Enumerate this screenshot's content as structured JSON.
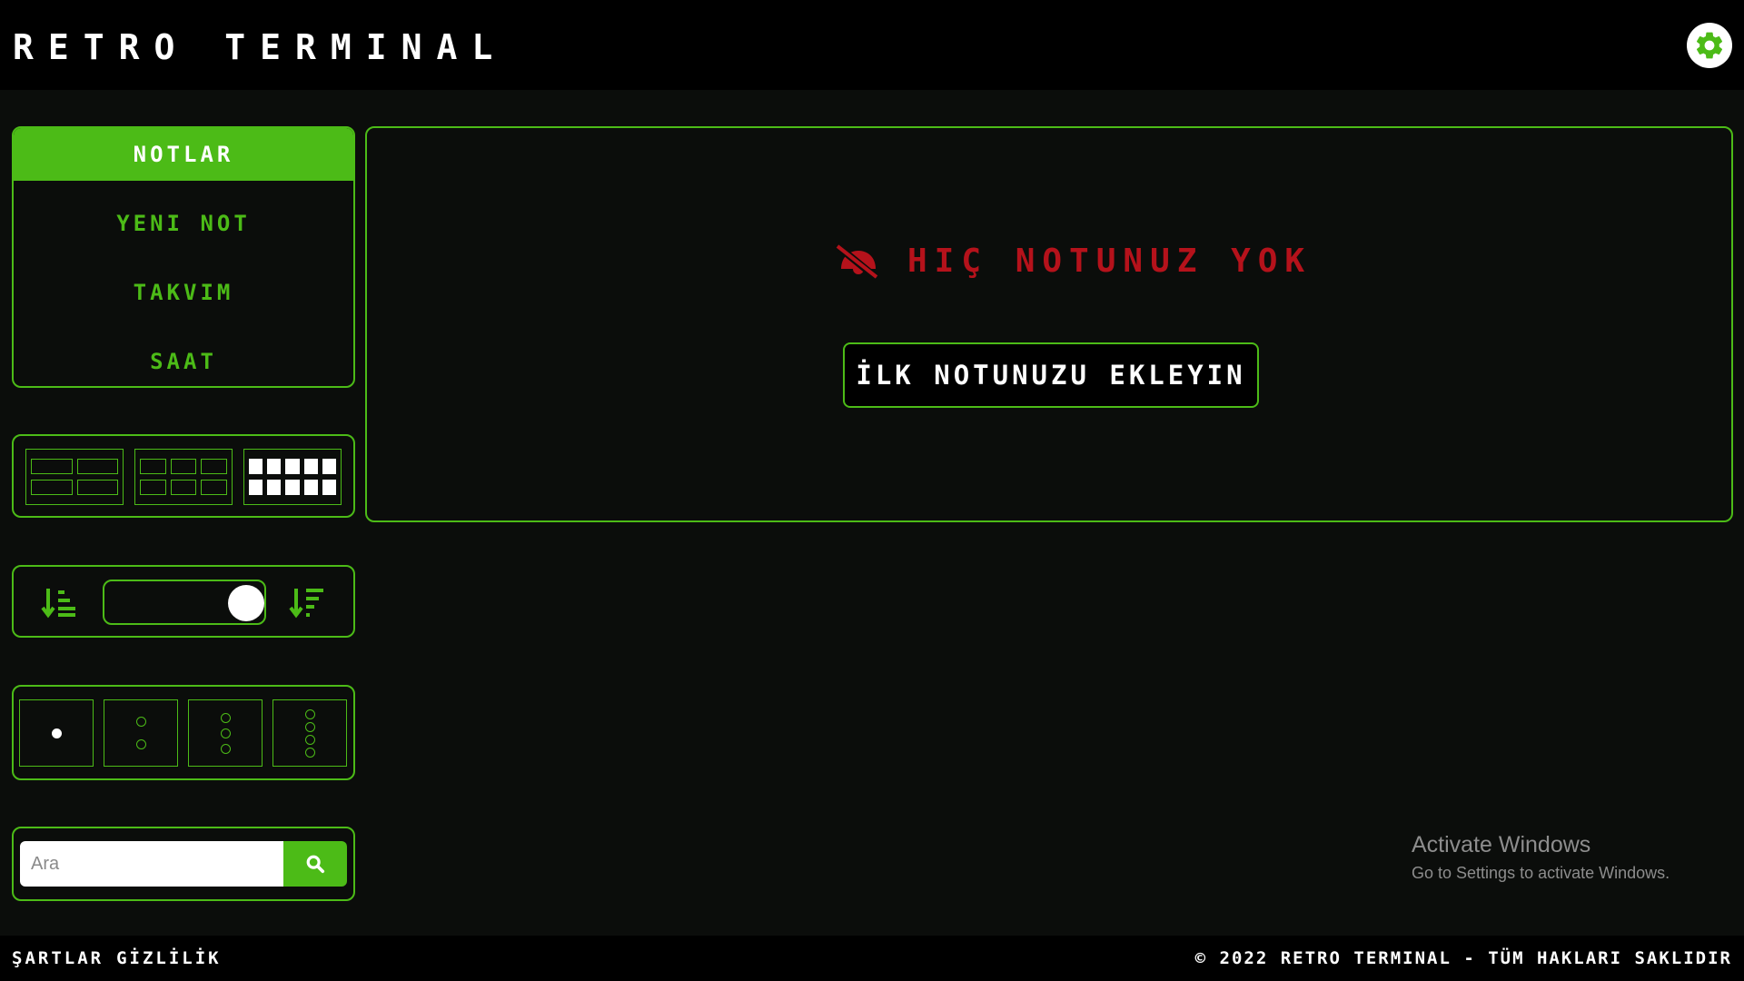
{
  "app": {
    "title": "RETRO TERMINAL"
  },
  "header": {
    "settings_icon": "gear-icon",
    "settings_color": "#4cbb17"
  },
  "sidebar": {
    "nav": [
      {
        "label": "NOTLAR",
        "active": true
      },
      {
        "label": "YENI NOT",
        "active": false
      },
      {
        "label": "TAKVIM",
        "active": false
      },
      {
        "label": "SAAT",
        "active": false
      }
    ],
    "layouts": [
      {
        "name": "2x2-grid",
        "selected": false
      },
      {
        "name": "3x2-grid",
        "selected": false
      },
      {
        "name": "5x2-grid",
        "selected": true
      }
    ],
    "sort": {
      "ascending_icon": "sort-ascending-icon",
      "descending_icon": "sort-descending-icon",
      "toggle_on": true
    },
    "columns": [
      {
        "count": 1,
        "selected": true
      },
      {
        "count": 2,
        "selected": false
      },
      {
        "count": 3,
        "selected": false
      },
      {
        "count": 4,
        "selected": false
      }
    ],
    "search": {
      "placeholder": "Ara",
      "value": "",
      "icon": "search-icon"
    }
  },
  "main": {
    "empty_icon": "no-notes-icon",
    "empty_message": "HIÇ NOTUNUZ YOK",
    "add_first_label": "İLK NOTUNUZU EKLEYIN"
  },
  "watermark": {
    "title": "Activate Windows",
    "subtitle": "Go to Settings to activate Windows."
  },
  "footer": {
    "links": [
      "ŞARTLAR",
      "GİZLİLİK"
    ],
    "copyright": "© 2022 RETRO TERMINAL - TÜM HAKLARI SAKLIDIR"
  },
  "colors": {
    "accent": "#4cbb17",
    "danger": "#b5121b",
    "background": "#0b0d0b",
    "bar": "#000000"
  }
}
